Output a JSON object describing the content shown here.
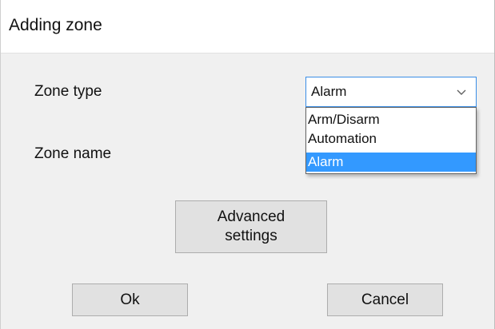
{
  "window": {
    "title": "Adding zone"
  },
  "form": {
    "zone_type_label": "Zone type",
    "zone_name_label": "Zone name",
    "zone_type_select": {
      "value": "Alarm",
      "options": [
        "Arm/Disarm",
        "Automation",
        "Alarm"
      ],
      "selected_index": 2,
      "expanded": true
    }
  },
  "buttons": {
    "advanced_line1": "Advanced",
    "advanced_line2": "settings",
    "ok": "Ok",
    "cancel": "Cancel"
  },
  "colors": {
    "selection_highlight": "#3399ff",
    "focus_border": "#3a8ee6",
    "dialog_background": "#f0f0f0",
    "button_face": "#e1e1e1"
  },
  "icons": {
    "combo_arrow": "chevron-down-icon"
  }
}
